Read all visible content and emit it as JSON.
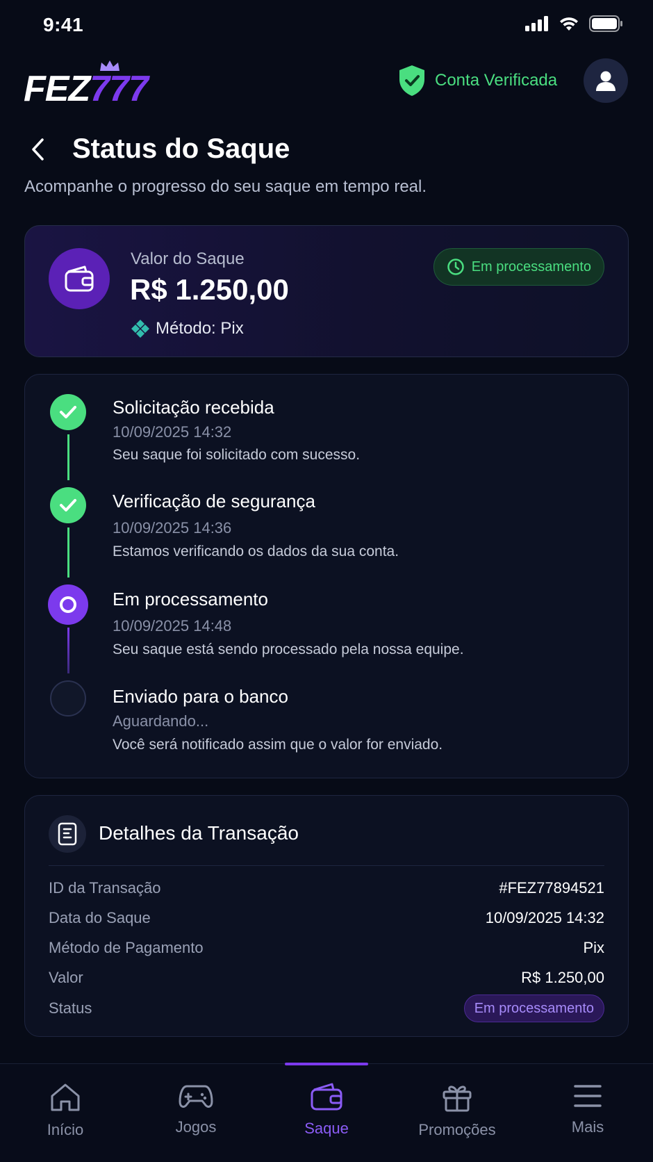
{
  "status_bar": {
    "time": "9:41"
  },
  "header": {
    "logo_text_1": "FEZ",
    "logo_text_2": "777",
    "verified_label": "Conta Verificada"
  },
  "page": {
    "title": "Status do Saque",
    "subtitle": "Acompanhe o progresso do seu saque em tempo real."
  },
  "amount_card": {
    "label": "Valor do Saque",
    "value": "R$ 1.250,00",
    "method": "Método: Pix",
    "status": "Em processamento"
  },
  "timeline": {
    "steps": [
      {
        "title": "Solicitação recebida",
        "time": "10/09/2025 14:32",
        "description": "Seu saque foi solicitado com sucesso.",
        "state": "done"
      },
      {
        "title": "Verificação de segurança",
        "time": "10/09/2025 14:36",
        "description": "Estamos verificando os dados da sua conta.",
        "state": "done"
      },
      {
        "title": "Em processamento",
        "time": "10/09/2025 14:48",
        "description": "Seu saque está sendo processado pela nossa equipe.",
        "state": "active"
      },
      {
        "title": "Enviado para o banco",
        "time": "Aguardando...",
        "description": "Você será notificado assim que o valor for enviado.",
        "state": "pending"
      }
    ]
  },
  "details": {
    "title": "Detalhes da Transação",
    "rows": [
      {
        "label": "ID da Transação",
        "value": "#FEZ77894521"
      },
      {
        "label": "Data do Saque",
        "value": "10/09/2025 14:32"
      },
      {
        "label": "Método de Pagamento",
        "value": "Pix"
      },
      {
        "label": "Valor",
        "value": "R$ 1.250,00"
      },
      {
        "label": "Status",
        "value": "Em processamento"
      }
    ]
  },
  "nav": {
    "items": [
      {
        "label": "Início",
        "icon": "home-icon"
      },
      {
        "label": "Jogos",
        "icon": "gamepad-icon"
      },
      {
        "label": "Saque",
        "icon": "wallet-icon",
        "active": true
      },
      {
        "label": "Promoções",
        "icon": "gift-icon"
      },
      {
        "label": "Mais",
        "icon": "menu-icon"
      }
    ]
  },
  "colors": {
    "background": "#070b17",
    "accent_purple": "#7c3aed",
    "success_green": "#4ade80"
  }
}
